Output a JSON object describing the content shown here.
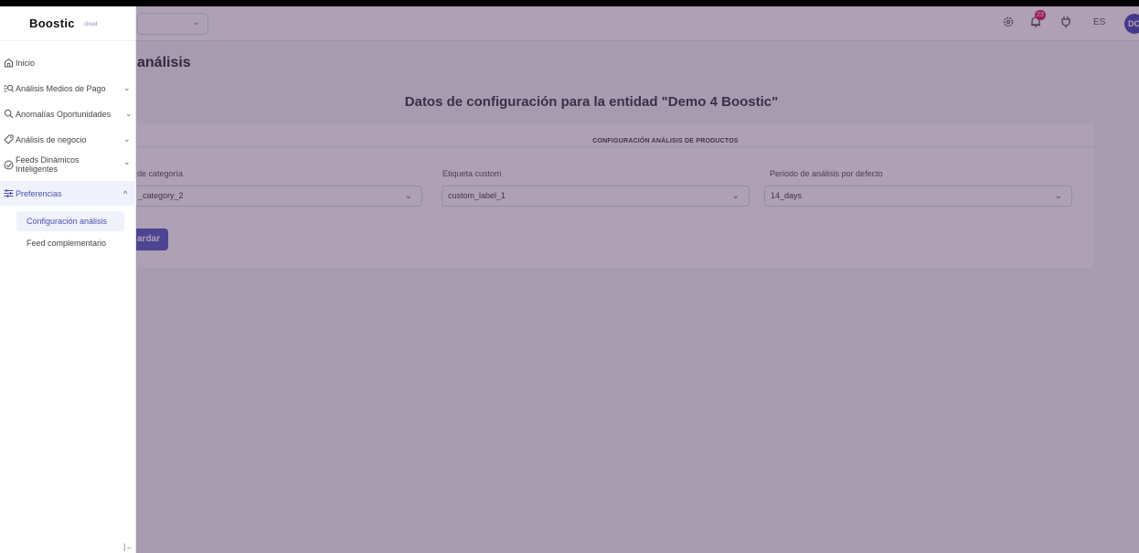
{
  "brand": {
    "name": "Boostic",
    "suffix": "cloud"
  },
  "sidebar": {
    "items": [
      {
        "label": "Inicio",
        "icon": "home-icon"
      },
      {
        "label": "Análisis Medios de Pago",
        "icon": "analytics-icon"
      },
      {
        "label": "Anomalías Oportunidades",
        "icon": "search-icon"
      },
      {
        "label": "Análisis de negocio",
        "icon": "tag-icon"
      },
      {
        "label_line1": "Feeds Dinámicos",
        "label_line2": "Inteligentes",
        "icon": "feed-icon"
      },
      {
        "label": "Preferencias",
        "icon": "sliders-icon"
      }
    ],
    "sub_items": [
      {
        "label": "Configuración análisis"
      },
      {
        "label": "Feed complementario"
      }
    ]
  },
  "topbar": {
    "notification_count": "23",
    "language": "ES",
    "avatar_initials": "DC"
  },
  "page": {
    "title": "análisis",
    "entity_heading": "Datos de configuración para la entidad \"Demo 4 Boostic\"",
    "section_title": "CONFIGURACIÓN ANÁLISIS DE PRODUCTOS",
    "fields": [
      {
        "label": "de categoría",
        "value": "_category_2"
      },
      {
        "label": "Etiqueta custom",
        "value": "custom_label_1"
      },
      {
        "label": "Periodo de análisis por defecto",
        "value": "14_days"
      }
    ],
    "save_label": "ardar"
  },
  "colors": {
    "accent": "#5b5fc7",
    "overlay": "#3c1e4b",
    "badge": "#e0245e"
  }
}
